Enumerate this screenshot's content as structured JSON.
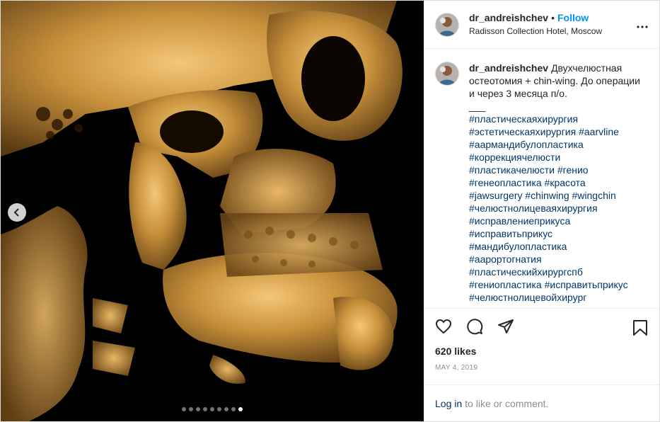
{
  "header": {
    "username": "dr_andreishchev",
    "separator": "•",
    "follow_label": "Follow",
    "location": "Radisson Collection Hotel, Moscow"
  },
  "caption": {
    "username": "dr_andreishchev",
    "text": "Двухчелюстная остеотомия + chin-wing. До операции и через 3 месяца п/о.",
    "divider": "___",
    "hashtags": [
      "#пластическаяхирургия",
      "#эстетическаяхирургия #aarvline",
      "#аармандибулопластика",
      "#коррекциячелюсти",
      "#пластикачелюсти #генио",
      "#генеопластика #красота",
      "#jawsurgery #chinwing #wingchin",
      "#челюстнолицеваяхирургия",
      "#исправлениеприкуса",
      "#исправитьприкус",
      "#мандибулопластика",
      "#аарортогнатия",
      "#пластическийхирургспб",
      "#гениопластика #исправитьприкус",
      "#челюстнолицевойхирург"
    ]
  },
  "post": {
    "likes": "620 likes",
    "date": "MAY 4, 2019"
  },
  "footer": {
    "login_label": "Log in",
    "login_suffix": "to like or comment."
  },
  "carousel": {
    "slide_count": 9,
    "active_index": 8
  },
  "icons": {
    "prev": "chevron-left-icon",
    "more": "more-options-icon",
    "like": "heart-icon",
    "comment": "comment-bubble-icon",
    "share": "paper-plane-icon",
    "save": "bookmark-icon"
  },
  "colors": {
    "link": "#0095f6",
    "hashtag": "#00376b",
    "muted": "#8e8e8e",
    "bone": "#d4a24a"
  }
}
